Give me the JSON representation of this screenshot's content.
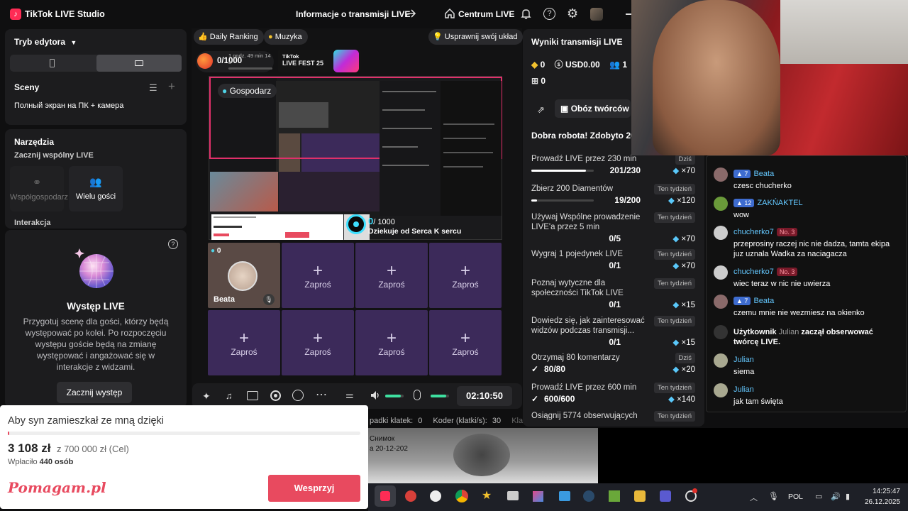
{
  "app": {
    "title": "TikTok LIVE Studio"
  },
  "header": {
    "stream_info": "Informacje o transmisji LIVE",
    "live_center": "Centrum LIVE"
  },
  "left": {
    "editor_mode": "Tryb edytora",
    "scenes_title": "Sceny",
    "scene_item": "Полный экран на ПК + камера",
    "tools_title": "Narzędzia",
    "cohost_title": "Zacznij wspólny LIVE",
    "cohost_btn": "Współgospodarz",
    "multi_btn": "Wielu gości",
    "interaction_title": "Interakcja",
    "performance_title": "Występ LIVE",
    "performance_desc": "Przygotuj scenę dla gości, którzy będą występować po kolei. Po rozpoczęciu występu goście będą na zmianę występować i angażować się w interakcje z widzami.",
    "performance_btn": "Zacznij występ"
  },
  "center": {
    "daily_ranking": "Daily Ranking",
    "music": "Muzyka",
    "improve": "Usprawnij swój układ",
    "counter": "0/1000",
    "timer_small": "1 godz. 49 min 14 s",
    "fest_line1": "TikTok",
    "fest_line2": "LIVE FEST 25",
    "host_label": "Gospodarz",
    "goal_count": "0",
    "goal_total": "/ 1000",
    "goal_thanks": "Dziekuje od Serca K sercu",
    "guest_count": "0",
    "guest_name": "Beata",
    "invite": "Zaproś",
    "elapsed": "02:10:50",
    "status_dropped": "padki klatek:",
    "status_dropped_val": "0",
    "status_encoder": "Koder (klatki/s):",
    "status_encoder_val": "30",
    "status_more": "Kla",
    "audio_level": 0.85,
    "mic_level": 0.85
  },
  "results": {
    "title": "Wyniki transmisji LIVE",
    "diamonds": "0",
    "usd": "USD0.00",
    "viewers": "1",
    "gifts": "0",
    "creators_btn": "Obóz twórców",
    "good_job": "Dobra robota! Zdobyto 20",
    "tasks": [
      {
        "title": "Prowadź LIVE przez 230 min",
        "tag": "Dziś",
        "progress": "201/230",
        "reward": "×70",
        "fraction": 0.874,
        "done": false
      },
      {
        "title": "Zbierz 200 Diamentów",
        "tag": "Ten tydzień",
        "progress": "19/200",
        "reward": "×120",
        "fraction": 0.095,
        "done": false
      },
      {
        "title": "Używaj Wspólne prowadzenie LIVE'a przez 5 min",
        "tag": "Ten tydzień",
        "progress": "0/5",
        "reward": "×70",
        "done": false
      },
      {
        "title": "Wygraj 1 pojedynek LIVE",
        "tag": "Ten tydzień",
        "progress": "0/1",
        "reward": "×70",
        "done": false
      },
      {
        "title": "Poznaj wytyczne dla społeczności TikTok LIVE",
        "tag": "Ten tydzień",
        "progress": "0/1",
        "reward": "×15",
        "done": false
      },
      {
        "title": "Dowiedz się, jak zainteresować widzów podczas transmisji...",
        "tag": "Ten tydzień",
        "progress": "0/1",
        "reward": "×15",
        "done": false
      },
      {
        "title": "Otrzymaj 80 komentarzy",
        "tag": "Dziś",
        "progress": "80/80",
        "reward": "×20",
        "done": true
      },
      {
        "title": "Prowadź LIVE przez 600 min",
        "tag": "Ten tydzień",
        "progress": "600/600",
        "reward": "×140",
        "done": true
      },
      {
        "title": "Osiągnij 5774 obserwujących",
        "tag": "Ten tydzień",
        "progress": "",
        "reward": "",
        "done": false
      }
    ]
  },
  "chat": {
    "messages": [
      {
        "user": "Beata",
        "level": "7",
        "text": "czesc chucherko"
      },
      {
        "user": "ZAKŃAKTEL",
        "level": "12",
        "text": "wow"
      },
      {
        "user": "chucherko7",
        "badge": "No. 3",
        "text": "przeprosiny raczej nic nie dadza, tamta ekipa juz uznala Wadka za naciagacza"
      },
      {
        "user": "chucherko7",
        "badge": "No. 3",
        "text": "wiec teraz w nic nie uwierza"
      },
      {
        "user": "Beata",
        "level": "7",
        "text": "czemu mnie nie wezmiesz na okienko"
      },
      {
        "system_prefix": "Użytkownik",
        "user": "Julian",
        "system_suffix": "zaczął obserwować twórcę LIVE."
      },
      {
        "user": "Julian",
        "text": "siema"
      },
      {
        "user": "Julian",
        "text": "jak tam święta"
      }
    ]
  },
  "fundraiser": {
    "title": "Aby syn zamieszkał ze mną dzięki",
    "raised": "3 108 zł",
    "goal": "z 700 000 zł (Cel)",
    "paid_label": "Wpłaciło",
    "paid_count": "440 osób",
    "logo": "Pomagam.pl",
    "button": "Wesprzyj",
    "fraction": 0.0044
  },
  "overlay": {
    "snapshot_label": "Снимок",
    "snapshot_date": "а 20-12-202"
  },
  "taskbar": {
    "lang": "POL",
    "time": "14:25:47",
    "date": "26.12.2025"
  },
  "colors": {
    "accent": "#fe2c55",
    "fundraiser_button": "#e84a5f",
    "slot": "#3c2a5a",
    "link": "#64c8ff",
    "goal": "#3ee0ff"
  }
}
